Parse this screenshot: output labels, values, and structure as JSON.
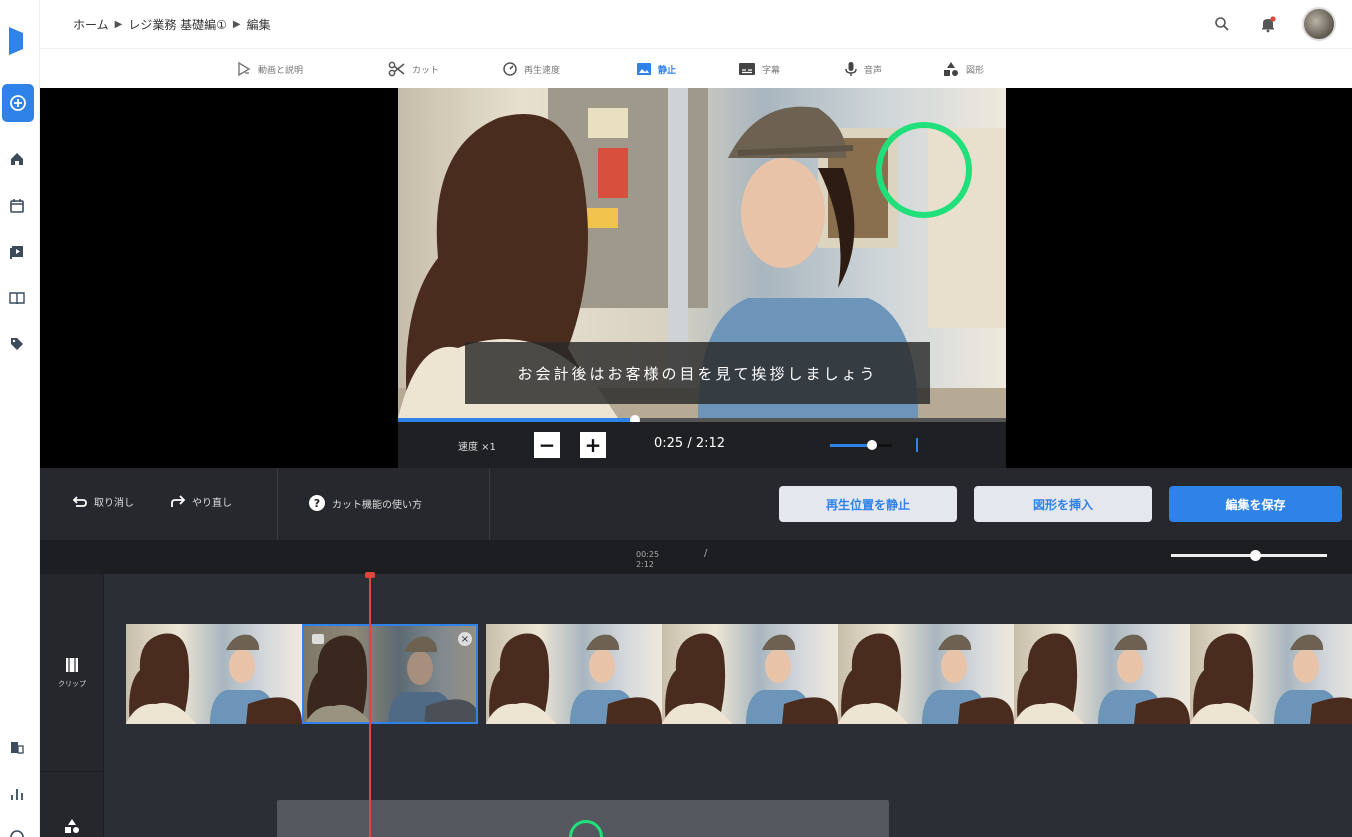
{
  "app": {
    "brand_color": "#2f82e8",
    "accent_green": "#1fe07a",
    "playhead_color": "#e0463b"
  },
  "breadcrumb": {
    "home": "ホーム",
    "course": "レジ業務 基礎編①",
    "current": "編集"
  },
  "header_icons": [
    "search-icon",
    "bell-icon",
    "avatar"
  ],
  "rail": {
    "items": [
      "add-icon",
      "home-icon",
      "calendar-icon",
      "video-library-icon",
      "book-icon",
      "tag-icon"
    ],
    "bottom_items": [
      "building-icon",
      "bar-chart-icon",
      "help-icon"
    ]
  },
  "tool_tabs": [
    {
      "label": "動画と説明",
      "icon": "video-edit-icon",
      "active": false
    },
    {
      "label": "カット",
      "icon": "scissors-icon",
      "active": false
    },
    {
      "label": "再生速度",
      "icon": "speed-icon",
      "active": false
    },
    {
      "label": "静止",
      "icon": "image-icon",
      "active": true
    },
    {
      "label": "字幕",
      "icon": "subtitles-icon",
      "active": false
    },
    {
      "label": "音声",
      "icon": "microphone-icon",
      "active": false
    },
    {
      "label": "図形",
      "icon": "shapes-icon",
      "active": false
    }
  ],
  "preview": {
    "subtitle": "お会計後はお客様の目を見て挨拶しましょう",
    "speed_label": "速度 ×1",
    "time_current": "0:25",
    "time_total": "2:12",
    "time_separator": "/",
    "progress_fraction": 0.39,
    "volume_fraction": 0.68
  },
  "toolbar": {
    "undo_label": "取り消し",
    "redo_label": "やり直し",
    "help_label": "カット機能の使い方",
    "stop_at_position_label": "再生位置を静止",
    "insert_shape_label": "図形を挿入",
    "save_label": "編集を保存"
  },
  "timeline": {
    "ruler_time": "00:25",
    "ruler_total": "2:12",
    "ruler_separator": "/",
    "zoom_fraction": 0.54,
    "clip_track_label": "クリップ",
    "thumbnail_count": 7,
    "selected_index": 1
  }
}
